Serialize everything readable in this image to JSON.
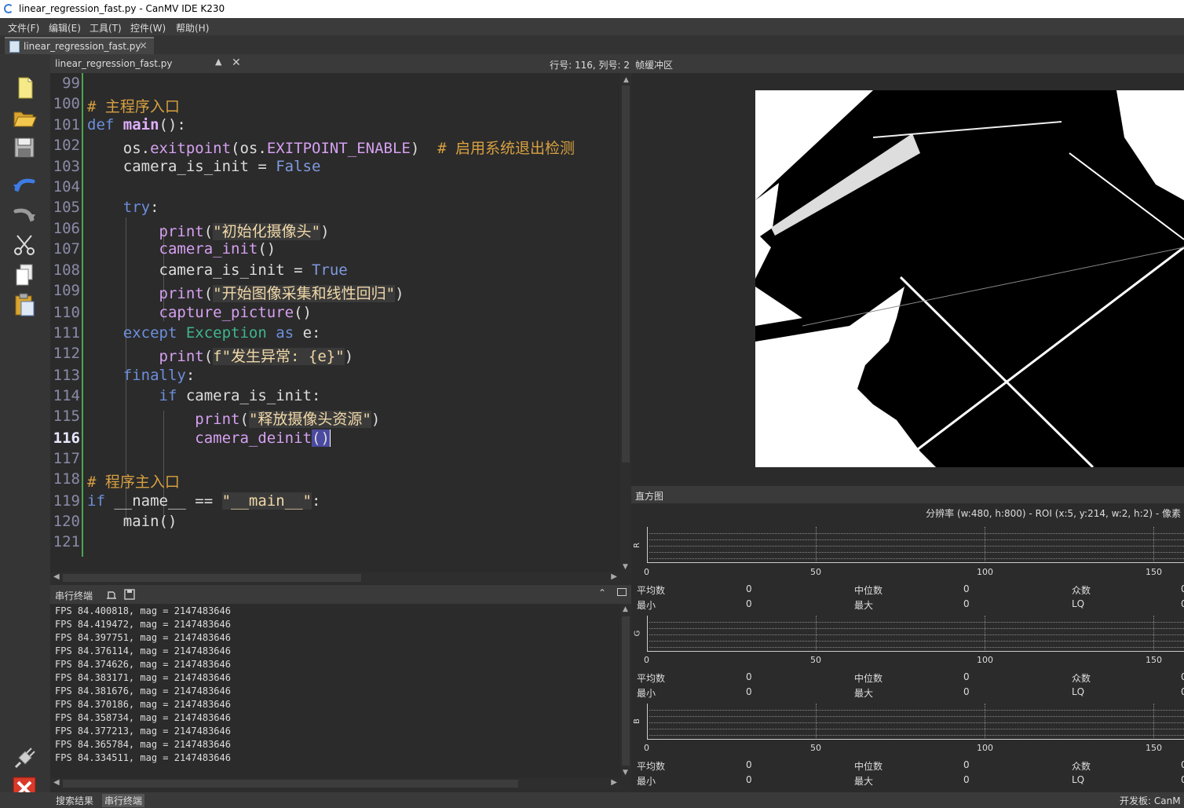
{
  "window": {
    "title": "linear_regression_fast.py - CanMV IDE K230"
  },
  "menu": [
    "文件(F)",
    "编辑(E)",
    "工具(T)",
    "控件(W)",
    "帮助(H)"
  ],
  "file_tab": {
    "label": "linear_regression_fast.py",
    "close": "×"
  },
  "editor_header": {
    "filename": "linear_regression_fast.py",
    "position": "行号: 116, 列号: 2"
  },
  "editor": {
    "line_numbers": [
      "99",
      "100",
      "101",
      "102",
      "103",
      "104",
      "105",
      "106",
      "107",
      "108",
      "109",
      "110",
      "111",
      "112",
      "113",
      "114",
      "115",
      "116",
      "117",
      "118",
      "119",
      "120",
      "121"
    ],
    "current_line": "116"
  },
  "code": {
    "l100_cmt": "# 主程序入口",
    "l101_def": "def",
    "l101_name": "main",
    "l101_rest": "():",
    "l102_a": "os.",
    "l102_b": "exitpoint",
    "l102_c": "(os.",
    "l102_d": "EXITPOINT_ENABLE",
    "l102_e": ")  ",
    "l102_cmt": "# 启用系统退出检测",
    "l103_a": "camera_is_init = ",
    "l103_b": "False",
    "l105": "try",
    "l105_colon": ":",
    "l106_fn": "print",
    "l106_str": "\"初始化摄像头\"",
    "l107_fn": "camera_init",
    "l107_rest": "()",
    "l108_a": "camera_is_init = ",
    "l108_b": "True",
    "l109_fn": "print",
    "l109_str": "\"开始图像采集和线性回归\"",
    "l110_fn": "capture_picture",
    "l110_rest": "()",
    "l111_kw": "except",
    "l111_cls": "Exception",
    "l111_as": "as",
    "l111_rest": " e:",
    "l112_fn": "print",
    "l112_str": "f\"发生异常: {e}\"",
    "l113": "finally",
    "l113_colon": ":",
    "l114_kw": "if",
    "l114_rest": " camera_is_init:",
    "l115_fn": "print",
    "l115_str": "\"释放摄像头资源\"",
    "l116_fn": "camera_deinit",
    "l116_rest": "()",
    "l118_cmt": "# 程序主入口",
    "l119_kw": "if",
    "l119_a": " __name__ == ",
    "l119_str": "\"__main__\"",
    "l119_rest": ":",
    "l120": "main()"
  },
  "serial": {
    "header": "串行终端",
    "lines": [
      "FPS 84.400818, mag = 2147483646",
      "FPS 84.419472, mag = 2147483646",
      "FPS 84.397751, mag = 2147483646",
      "FPS 84.376114, mag = 2147483646",
      "FPS 84.374626, mag = 2147483646",
      "FPS 84.383171, mag = 2147483646",
      "FPS 84.381676, mag = 2147483646",
      "FPS 84.370186, mag = 2147483646",
      "FPS 84.358734, mag = 2147483646",
      "FPS 84.377213, mag = 2147483646",
      "FPS 84.365784, mag = 2147483646",
      "FPS 84.334511, mag = 2147483646"
    ]
  },
  "frame_buffer": {
    "header": "帧缓冲区"
  },
  "histogram": {
    "header": "直方图",
    "resolution": "分辨率 (w:480, h:800) - ROI (x:5, y:214, w:2, h:2) - 像素",
    "ticks": [
      "0",
      "50",
      "100",
      "150"
    ],
    "channels": [
      {
        "name": "R",
        "mean_label": "平均数",
        "mean": "0",
        "median_label": "中位数",
        "median": "0",
        "mode_label": "众数",
        "mode": "0",
        "min_label": "最小",
        "min": "0",
        "max_label": "最大",
        "max": "0",
        "lq_label": "LQ",
        "lq": "0"
      },
      {
        "name": "G",
        "mean_label": "平均数",
        "mean": "0",
        "median_label": "中位数",
        "median": "0",
        "mode_label": "众数",
        "mode": "0",
        "min_label": "最小",
        "min": "0",
        "max_label": "最大",
        "max": "0",
        "lq_label": "LQ",
        "lq": "0"
      },
      {
        "name": "B",
        "mean_label": "平均数",
        "mean": "0",
        "median_label": "中位数",
        "median": "0",
        "mode_label": "众数",
        "mode": "0",
        "min_label": "最小",
        "min": "0",
        "max_label": "最大",
        "max": "0",
        "lq_label": "LQ",
        "lq": "0"
      }
    ]
  },
  "bottom_tabs": [
    "搜索结果",
    "串行终端"
  ],
  "status": {
    "board": "开发板: CanM"
  },
  "toolbar_icons": [
    "new-file-icon",
    "open-folder-icon",
    "save-icon",
    "undo-icon",
    "redo-icon",
    "cut-icon",
    "copy-icon",
    "paste-icon",
    "connect-icon",
    "stop-icon"
  ]
}
